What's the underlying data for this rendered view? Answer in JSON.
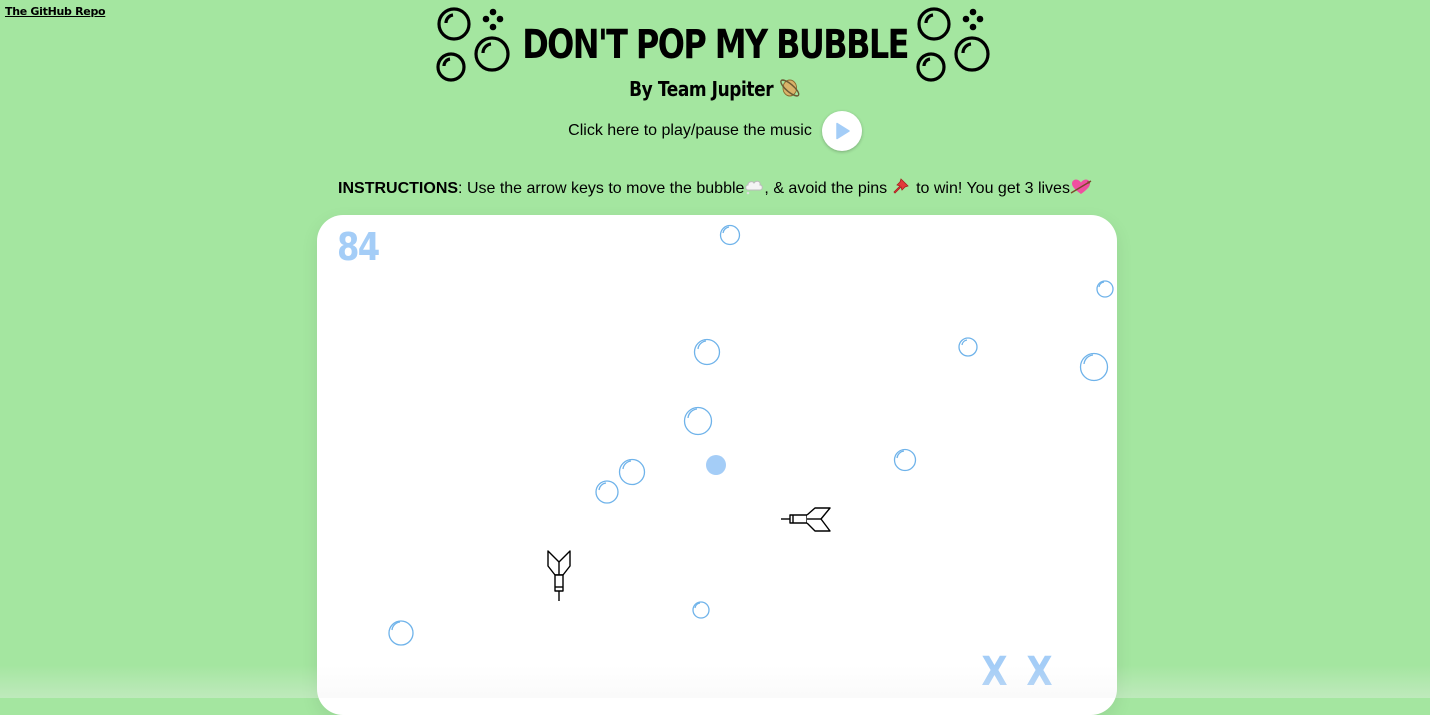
{
  "header": {
    "repo_link": "The GitHub Repo",
    "title": "DON'T POP MY BUBBLE",
    "subtitle": "By Team Jupiter",
    "subtitle_emoji": "planet-icon"
  },
  "music": {
    "label": "Click here to play/pause the music",
    "button_icon": "play-icon"
  },
  "instructions": {
    "bold": "INSTRUCTIONS",
    "text1": ": Use the arrow keys to move the bubble",
    "text2": ", & avoid the pins",
    "text3": " to win! You get 3 lives"
  },
  "game": {
    "score": "84",
    "lives_lost": [
      "X",
      "X"
    ],
    "player_bubble_color": "#a4cdf7",
    "bubble_color": "#6fb3ea",
    "score_color": "#a4cdf7"
  },
  "colors": {
    "background": "#a4e6a0",
    "board": "#ffffff"
  }
}
